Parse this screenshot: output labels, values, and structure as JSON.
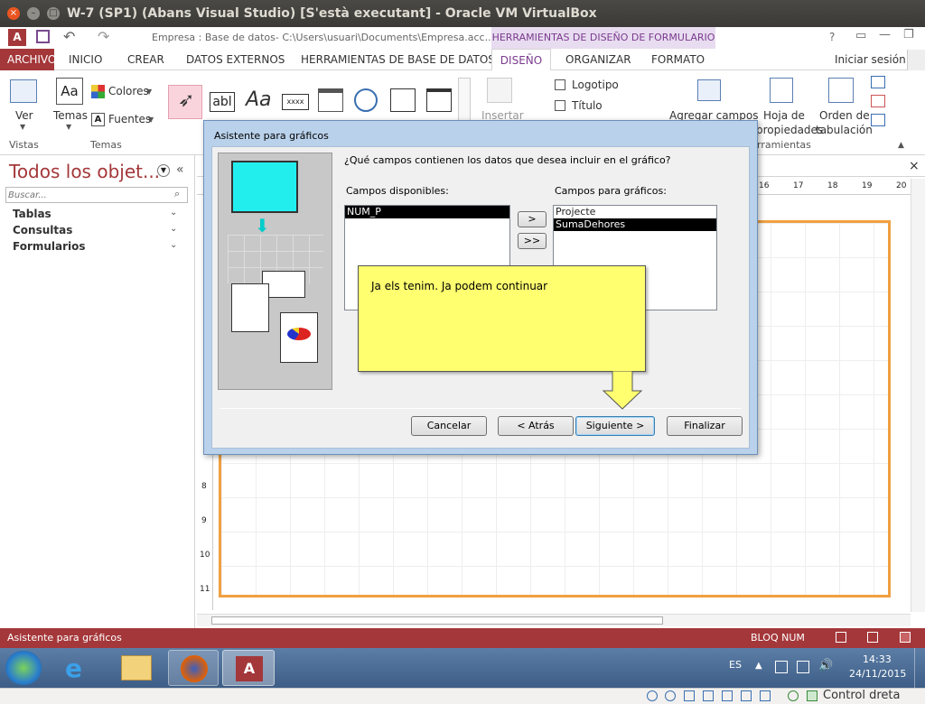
{
  "window": {
    "title": "W-7 (SP1) (Abans Visual Studio) [S'està executant] - Oracle VM VirtualBox"
  },
  "qat": {
    "doc_path": "Empresa : Base de datos- C:\\Users\\usuari\\Documents\\Empresa.acc...",
    "help": "?"
  },
  "ribbon": {
    "context_group": "HERRAMIENTAS DE DISEÑO DE FORMULARIO",
    "tabs": [
      "ARCHIVO",
      "INICIO",
      "CREAR",
      "DATOS EXTERNOS",
      "HERRAMIENTAS DE BASE DE DATOS",
      "DISEÑO",
      "ORGANIZAR",
      "FORMATO"
    ],
    "signin": "Iniciar sesión",
    "ver": "Ver",
    "temas": "Temas",
    "colores": "Colores",
    "fuentes": "Fuentes",
    "textbox_icon_text": "abl",
    "label_icon_text": "Aa",
    "button_icon_text": "xxxx",
    "insertar": "Insertar",
    "logotipo": "Logotipo",
    "titulo": "Título",
    "agregar_campos": "Agregar campos",
    "hoja_prop": "Hoja de",
    "hoja_prop2": "propiedades",
    "orden": "Orden de",
    "orden2": "tabulación",
    "grp_vistas": "Vistas",
    "grp_temas": "Temas",
    "grp_herr": "rramientas"
  },
  "nav": {
    "title": "Todos los objet...",
    "search_placeholder": "Buscar...",
    "groups": [
      "Tablas",
      "Consultas",
      "Formularios"
    ]
  },
  "ruler": {
    "top": [
      "16",
      "17",
      "18",
      "19",
      "20"
    ],
    "left": [
      "8",
      "9",
      "10",
      "11"
    ]
  },
  "dialog": {
    "title": "Asistente para gráficos",
    "question": "¿Qué campos contienen los datos que desea incluir en el gráfico?",
    "available_label": "Campos disponibles:",
    "available": [
      "NUM_P"
    ],
    "chart_label": "Campos para gráficos:",
    "chart_fields": [
      "Projecte",
      "SumaDehores"
    ],
    "btn_add": ">",
    "btn_add_all": ">>",
    "btn_cancel": "Cancelar",
    "btn_back": "< Atrás",
    "btn_next": "Siguiente >",
    "btn_finish": "Finalizar"
  },
  "callout": {
    "text": "Ja els tenim. Ja podem continuar"
  },
  "status": {
    "left": "Asistente para gráficos",
    "right": "BLOQ NUM"
  },
  "taskbar": {
    "lang": "ES",
    "time": "14:33",
    "date": "24/11/2015",
    "access_icon_text": "A"
  },
  "vbox": {
    "hostkey": "Control dreta"
  },
  "colors": {
    "access_red": "#a4373a",
    "context_purple": "#7a3b8e",
    "callout": "#ffff70",
    "form_border": "#f0a040"
  }
}
